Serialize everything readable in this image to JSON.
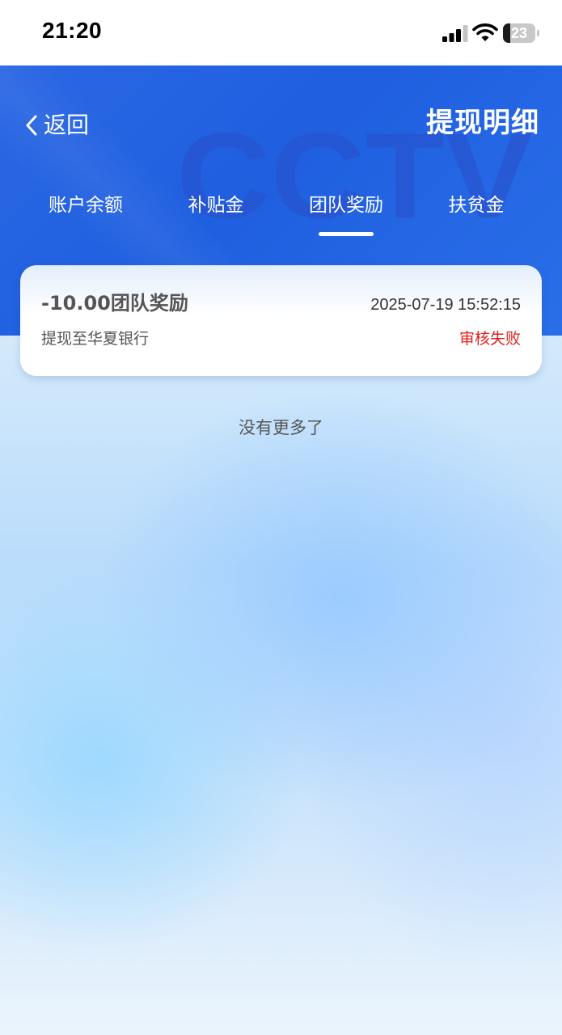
{
  "status_bar": {
    "time": "21:20",
    "battery_level": "23",
    "icons": [
      "signal-icon",
      "wifi-icon",
      "battery-icon"
    ]
  },
  "header": {
    "back_label": "返回",
    "title": "提现明细",
    "watermark_logo": "CCTV",
    "icons": [
      "chevron-left-icon"
    ]
  },
  "tabs": [
    {
      "label": "账户余额",
      "active": false
    },
    {
      "label": "补贴金",
      "active": false
    },
    {
      "label": "团队奖励",
      "active": true
    },
    {
      "label": "扶贫金",
      "active": false
    }
  ],
  "records": [
    {
      "title": "-10.00团队奖励",
      "time": "2025-07-19 15:52:15",
      "destination": "提现至华夏银行",
      "status": "审核失败"
    }
  ],
  "list_end_text": "没有更多了",
  "colors": {
    "header_blue": "#2163E3",
    "status_failed": "#E11F1F",
    "text_gray": "#555555"
  }
}
